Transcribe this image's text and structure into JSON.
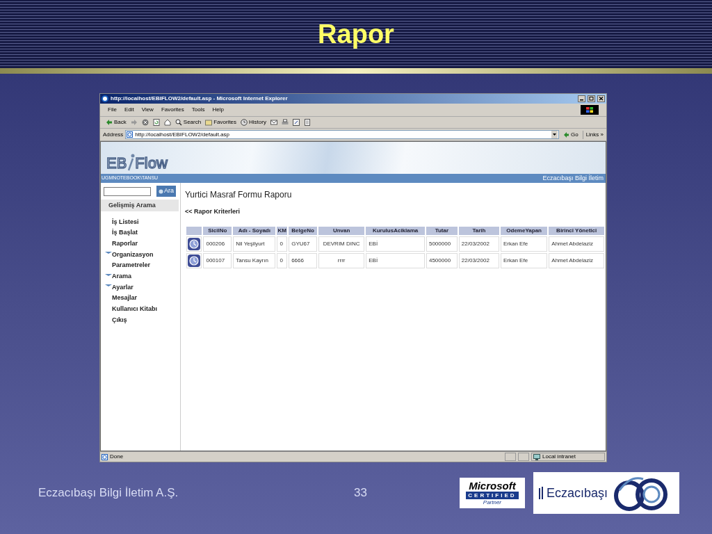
{
  "slide": {
    "title": "Rapor",
    "footer": "Eczacıbaşı Bilgi İletim A.Ş.",
    "page_number": "33"
  },
  "browser": {
    "title": "http://localhost/EBIFLOW2/default.asp - Microsoft Internet Explorer",
    "menu": [
      "File",
      "Edit",
      "View",
      "Favorites",
      "Tools",
      "Help"
    ],
    "toolbar": [
      "Back",
      "Search",
      "Favorites",
      "History"
    ],
    "address_label": "Address",
    "address": "http://localhost/EBIFLOW2/default.asp",
    "go": "Go",
    "links": "Links",
    "links_more": "»",
    "status": "Done",
    "zone": "Local intranet"
  },
  "app": {
    "logo_left": "EB",
    "logo_right": "Flow",
    "user": "UGMNOTEBOOK\\TANSU",
    "company": "Eczacıbaşı Bilgi İletim",
    "search_button": "Ara",
    "advanced_search": "Gelişmiş Arama",
    "sidebar": [
      {
        "label": "İş Listesi",
        "kind": "link"
      },
      {
        "label": "İş Başlat",
        "kind": "link"
      },
      {
        "label": "Raporlar",
        "kind": "link"
      },
      {
        "label": "Organizasyon",
        "kind": "group",
        "expanded": true
      },
      {
        "label": "Parametreler",
        "kind": "link"
      },
      {
        "label": "Arama",
        "kind": "group",
        "expanded": true
      },
      {
        "label": "Ayarlar",
        "kind": "group",
        "expanded": true
      },
      {
        "label": "Mesajlar",
        "kind": "link"
      },
      {
        "label": "Kullanıcı Kitabı",
        "kind": "link"
      },
      {
        "label": "Çıkış",
        "kind": "link"
      }
    ],
    "heading": "Yurtici Masraf Formu Raporu",
    "back_link": "<< Rapor Kriterleri",
    "table": {
      "columns": [
        "SicilNo",
        "Adı - Soyadı",
        "KM",
        "BelgeNo",
        "Unvan",
        "KurulusAciklama",
        "Tutar",
        "Tarih",
        "OdemeYapan",
        "Birinci Yönetici"
      ],
      "rows": [
        [
          "000206",
          "Nil Yeşilyurt",
          "0",
          "GYU67",
          "DEVRIM DINC",
          "EBİ",
          "5000000",
          "22/03/2002",
          "Erkan Efe",
          "Ahmet Abdelaziz"
        ],
        [
          "000107",
          "Tansu Kayrın",
          "0",
          "6666",
          "rrrr",
          "EBİ",
          "4500000",
          "22/03/2002",
          "Erkan Efe",
          "Ahmet Abdelaziz"
        ]
      ]
    }
  },
  "logos": {
    "microsoft": "Microsoft",
    "certified": "CERTIFIED",
    "partner": "Partner",
    "eczacibasi": "Eczacıbaşı"
  }
}
